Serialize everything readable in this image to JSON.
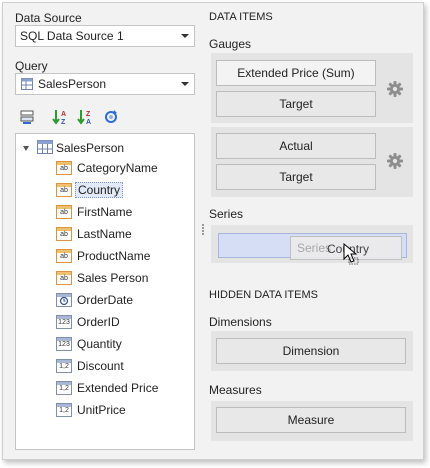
{
  "datasource": {
    "label": "Data Source",
    "value": "SQL Data Source 1"
  },
  "query": {
    "label": "Query",
    "value": "SalesPerson"
  },
  "tree": {
    "root": "SalesPerson",
    "items": [
      {
        "label": "CategoryName",
        "type": "ab"
      },
      {
        "label": "Country",
        "type": "ab"
      },
      {
        "label": "FirstName",
        "type": "ab"
      },
      {
        "label": "LastName",
        "type": "ab"
      },
      {
        "label": "ProductName",
        "type": "ab"
      },
      {
        "label": "Sales Person",
        "type": "ab"
      },
      {
        "label": "OrderDate",
        "type": "date"
      },
      {
        "label": "OrderID",
        "type": "123"
      },
      {
        "label": "Quantity",
        "type": "123"
      },
      {
        "label": "Discount",
        "type": "1,2"
      },
      {
        "label": "Extended Price",
        "type": "1,2"
      },
      {
        "label": "UnitPrice",
        "type": "1,2"
      }
    ]
  },
  "data_items": {
    "header": "DATA ITEMS",
    "gauges_label": "Gauges",
    "gauge1": {
      "value": "Extended Price (Sum)",
      "target": "Target"
    },
    "gauge2": {
      "value": "Actual",
      "target": "Target"
    },
    "series_label": "Series",
    "series_placeholder": "Series",
    "drag_label": "Country"
  },
  "hidden": {
    "header": "HIDDEN DATA ITEMS",
    "dimensions_label": "Dimensions",
    "dimension": "Dimension",
    "measures_label": "Measures",
    "measure": "Measure"
  },
  "colors": {
    "drop_target": "#d6def6",
    "panel": "#f2f2f2",
    "selection": "#e3eaf7"
  },
  "icons": {
    "tree_root": "table-icon",
    "toolbar": [
      "group-fields-icon",
      "sort-ascending-icon",
      "sort-descending-icon",
      "refresh-icon"
    ],
    "gauge_options": "gear-icon",
    "cursor": "cursor-arrow-icon"
  }
}
